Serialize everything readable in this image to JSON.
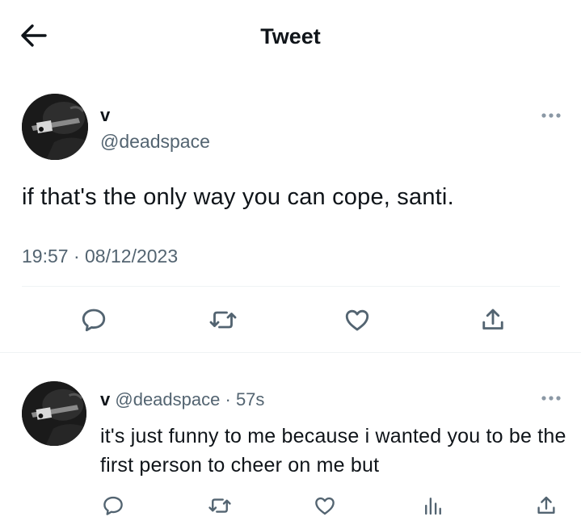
{
  "header": {
    "title": "Tweet",
    "back_icon": "arrow-left-icon"
  },
  "main_tweet": {
    "display_name": "v",
    "handle": "@deadspace",
    "text": "if that's the only way you can cope, santi.",
    "time": "19:57",
    "separator": "·",
    "date": "08/12/2023",
    "actions": [
      "reply-icon",
      "retweet-icon",
      "like-icon",
      "share-icon"
    ]
  },
  "reply": {
    "display_name": "v",
    "handle": "@deadspace",
    "separator": "·",
    "time": "57s",
    "text": "it's just funny to me because i wanted you to be the first person to cheer on me but",
    "actions": [
      "reply-icon",
      "retweet-icon",
      "like-icon",
      "views-icon",
      "share-icon"
    ]
  },
  "colors": {
    "text": "#0f1419",
    "secondary": "#536471",
    "divider": "#eff3f4"
  }
}
